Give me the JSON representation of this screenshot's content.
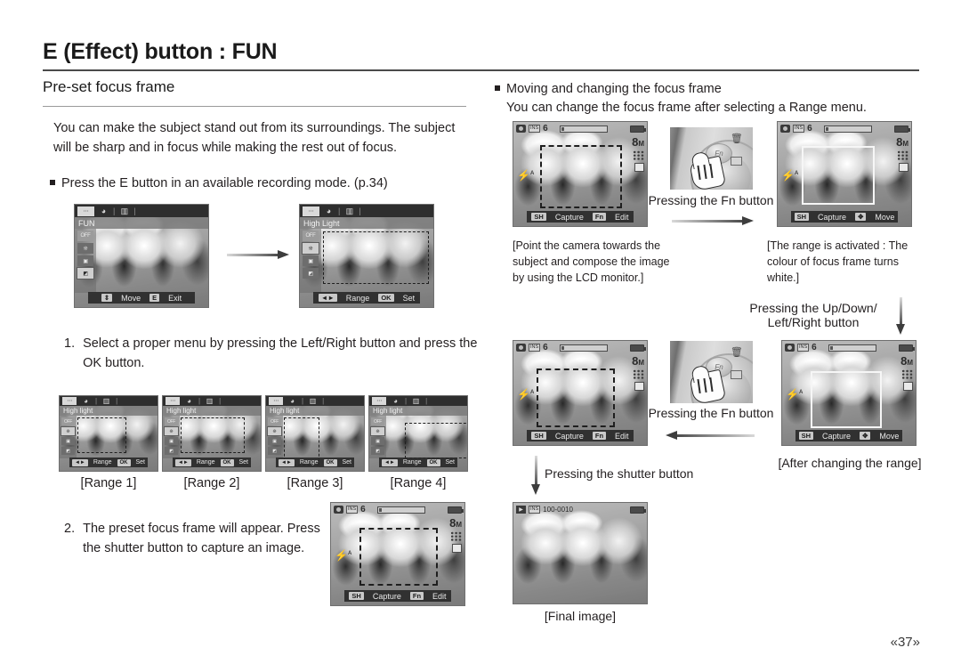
{
  "page": {
    "title": "E (Effect) button : FUN",
    "folio": "«37»"
  },
  "left": {
    "section_title": "Pre-set focus frame",
    "intro": "You can make the subject stand out from its surroundings. The subject will be sharp and in focus while making the rest out of focus.",
    "bullet": "Press the E button in an available recording mode. (p.34)",
    "step1_num": "1.",
    "step1_text": "Select a proper menu by pressing the Left/Right button and press the OK button.",
    "step2_num": "2.",
    "step2_text": "The preset focus frame will appear. Press the shutter button to capture an image.",
    "screen_fun": {
      "menu_title": "FUN",
      "tab_chip": "",
      "tab_icons": [
        "palette-icon",
        "histogram-icon"
      ],
      "side_items": [
        "OFF",
        "effect-icon",
        "frame-icon",
        "highlight-icon"
      ],
      "bottom": [
        {
          "key": "updown-icon",
          "label": "Move"
        },
        {
          "key": "E",
          "label": "Exit"
        }
      ]
    },
    "screen_highlight": {
      "menu_title": "High Light",
      "side_items": [
        "OFF",
        "effect-icon",
        "frame-icon",
        "highlight-icon"
      ],
      "bottom": [
        {
          "key": "leftright-icon",
          "label": "Range"
        },
        {
          "key": "OK",
          "label": "Set"
        }
      ]
    },
    "ranges": [
      {
        "caption": "[Range 1]",
        "menu_title": "High light",
        "bottom_key1": "leftright-icon",
        "bottom_label1": "Range",
        "bottom_key2": "OK",
        "bottom_label2": "Set"
      },
      {
        "caption": "[Range 2]",
        "menu_title": "High light",
        "bottom_key1": "leftright-icon",
        "bottom_label1": "Range",
        "bottom_key2": "OK",
        "bottom_label2": "Set"
      },
      {
        "caption": "[Range 3]",
        "menu_title": "High light",
        "bottom_key1": "leftright-icon",
        "bottom_label1": "Range",
        "bottom_key2": "OK",
        "bottom_label2": "Set"
      },
      {
        "caption": "[Range 4]",
        "menu_title": "High light",
        "bottom_key1": "leftright-icon",
        "bottom_label1": "Range",
        "bottom_key2": "OK",
        "bottom_label2": "Set"
      }
    ],
    "screen_step2": {
      "card": "INS",
      "shots": "6",
      "resolution": "8",
      "res_unit": "M",
      "bottom": [
        {
          "key": "SH",
          "label": "Capture"
        },
        {
          "key": "Fn",
          "label": "Edit"
        }
      ]
    }
  },
  "right": {
    "bullet": "Moving and changing the focus frame",
    "bullet_sub": "You can change the focus frame after selecting a Range menu.",
    "screen_a": {
      "card": "INS",
      "shots": "6",
      "resolution": "8",
      "res_unit": "M",
      "bottom": [
        {
          "key": "SH",
          "label": "Capture"
        },
        {
          "key": "Fn",
          "label": "Edit"
        }
      ]
    },
    "screen_b": {
      "card": "INS",
      "shots": "6",
      "resolution": "8",
      "res_unit": "M",
      "bottom": [
        {
          "key": "SH",
          "label": "Capture"
        },
        {
          "key": "joypad-icon",
          "label": "Move"
        }
      ]
    },
    "screen_c": {
      "card": "INS",
      "shots": "6",
      "resolution": "8",
      "res_unit": "M",
      "bottom": [
        {
          "key": "SH",
          "label": "Capture"
        },
        {
          "key": "Fn",
          "label": "Edit"
        }
      ]
    },
    "screen_d": {
      "card": "INS",
      "shots": "6",
      "resolution": "8",
      "res_unit": "M",
      "bottom": [
        {
          "key": "SH",
          "label": "Capture"
        },
        {
          "key": "joypad-icon",
          "label": "Move"
        }
      ]
    },
    "screen_final": {
      "card": "INS",
      "file": "100-0010"
    },
    "fn_button_label": "Fn",
    "press_fn_1": "Pressing the Fn button",
    "press_fn_2": "Pressing the Fn button",
    "caption_left_1": "[Point the camera towards the subject and compose the image by using the LCD monitor.]",
    "caption_right_1": "[The range is activated : The colour of focus frame turns white.]",
    "press_updown": "Pressing the Up/Down/ Left/Right  button",
    "caption_after": "[After changing the range]",
    "press_shutter": "Pressing the shutter button",
    "caption_final": "[Final image]"
  }
}
